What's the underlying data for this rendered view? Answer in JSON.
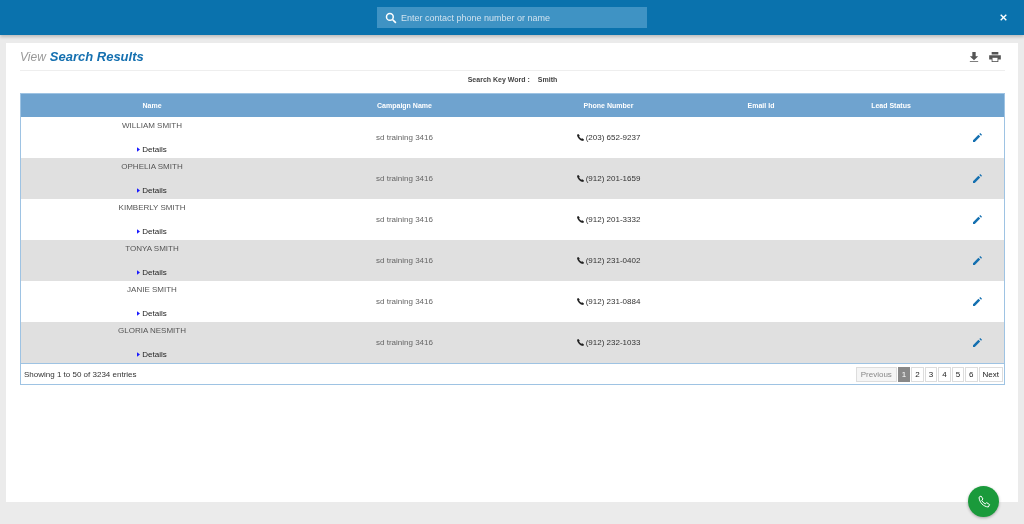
{
  "search": {
    "placeholder": "Enter contact phone number or name"
  },
  "page": {
    "title_prefix": "View",
    "title": "Search Results",
    "keyword_label": "Search Key Word :",
    "keyword": "Smith"
  },
  "table": {
    "columns": [
      "Name",
      "Campaign Name",
      "Phone Number",
      "Email Id",
      "Lead Status"
    ],
    "rows": [
      {
        "name": "WILLIAM SMITH",
        "details": "Details",
        "campaign": "sd training 3416",
        "phone": "(203) 652-9237"
      },
      {
        "name": "OPHELIA SMITH",
        "details": "Details",
        "campaign": "sd training 3416",
        "phone": "(912) 201-1659"
      },
      {
        "name": "KIMBERLY SMITH",
        "details": "Details",
        "campaign": "sd training 3416",
        "phone": "(912) 201-3332"
      },
      {
        "name": "TONYA SMITH",
        "details": "Details",
        "campaign": "sd training 3416",
        "phone": "(912) 231-0402"
      },
      {
        "name": "JANIE SMITH",
        "details": "Details",
        "campaign": "sd training 3416",
        "phone": "(912) 231-0884"
      },
      {
        "name": "GLORIA NESMITH",
        "details": "Details",
        "campaign": "sd training 3416",
        "phone": "(912) 232-1033"
      }
    ]
  },
  "footer": {
    "info": "Showing 1 to 50 of 3234 entries",
    "previous": "Previous",
    "next": "Next",
    "pages": [
      {
        "label": "1",
        "selected": true
      },
      {
        "label": "2",
        "selected": false
      },
      {
        "label": "3",
        "selected": false
      },
      {
        "label": "4",
        "selected": false
      },
      {
        "label": "5",
        "selected": false
      },
      {
        "label": "6",
        "selected": false
      }
    ]
  }
}
